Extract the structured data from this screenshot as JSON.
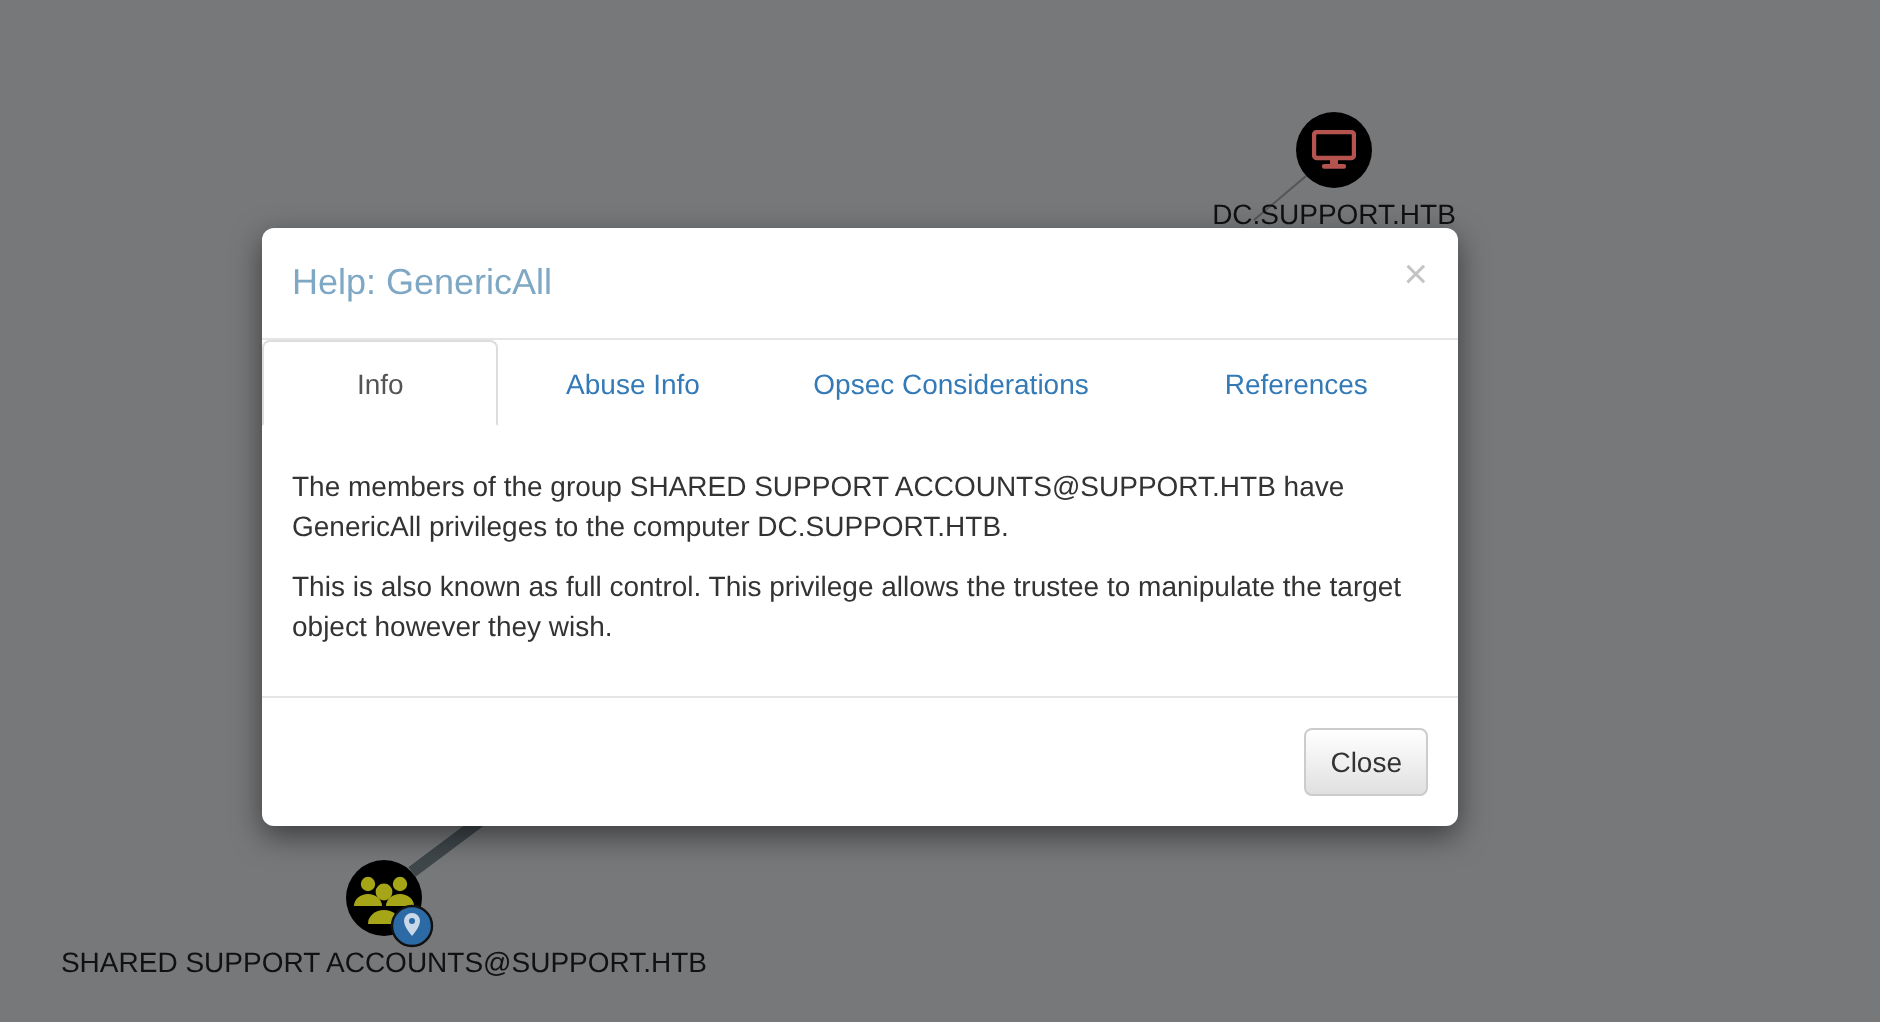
{
  "graph": {
    "nodes": [
      {
        "kind": "computer",
        "label": "DC.SUPPORT.HTB"
      },
      {
        "kind": "group",
        "label": "SHARED SUPPORT ACCOUNTS@SUPPORT.HTB"
      }
    ]
  },
  "modal": {
    "title": "Help: GenericAll",
    "close": "×",
    "tabs": [
      {
        "label": "Info",
        "selected": true
      },
      {
        "label": "Abuse Info",
        "selected": false
      },
      {
        "label": "Opsec Considerations",
        "selected": false
      },
      {
        "label": "References",
        "selected": false
      }
    ],
    "paragraphs": [
      "The members of the group SHARED SUPPORT ACCOUNTS@SUPPORT.HTB have GenericAll privileges to the computer DC.SUPPORT.HTB.",
      "This is also known as full control. This privilege allows the trustee to manipulate the target object however they wish."
    ],
    "buttons": [
      "Close"
    ]
  }
}
